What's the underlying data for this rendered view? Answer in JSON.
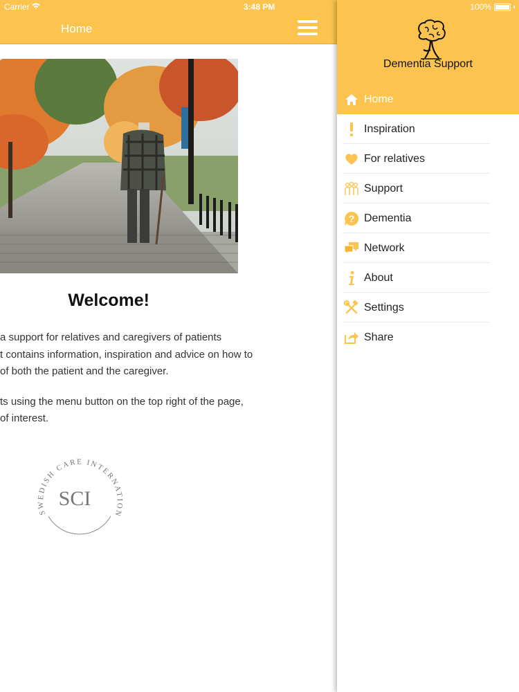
{
  "status_bar": {
    "carrier": "Carrier",
    "time": "3:48 PM",
    "battery": "100%"
  },
  "main": {
    "nav_title": "Home",
    "welcome": "Welcome!",
    "paragraphs": [
      [
        "a support for relatives and caregivers of patients",
        "t contains information, inspiration and advice on how to",
        " of both the patient and the caregiver."
      ],
      [
        "ts using the menu button on the top right of the page,",
        " of interest."
      ]
    ],
    "logo": {
      "monogram": "SCI",
      "ring_text": "SWEDISH CARE INTERNATIONAL"
    }
  },
  "menu": {
    "app_name": "Dementia Support",
    "accent": "#fcc44e",
    "items": [
      {
        "label": "Home",
        "icon": "home-icon",
        "active": true
      },
      {
        "label": "Inspiration",
        "icon": "exclamation-icon",
        "active": false
      },
      {
        "label": "For relatives",
        "icon": "heart-icon",
        "active": false
      },
      {
        "label": "Support",
        "icon": "people-icon",
        "active": false
      },
      {
        "label": "Dementia",
        "icon": "question-icon",
        "active": false
      },
      {
        "label": "Network",
        "icon": "chat-icon",
        "active": false
      },
      {
        "label": "About",
        "icon": "info-icon",
        "active": false
      },
      {
        "label": "Settings",
        "icon": "tools-icon",
        "active": false
      },
      {
        "label": "Share",
        "icon": "share-icon",
        "active": false
      }
    ]
  }
}
